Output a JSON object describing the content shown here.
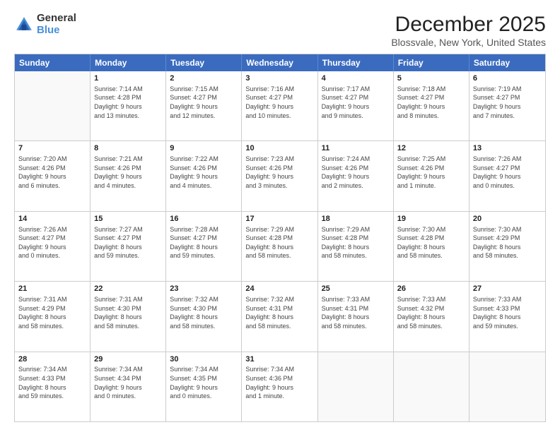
{
  "logo": {
    "general": "General",
    "blue": "Blue"
  },
  "title": "December 2025",
  "subtitle": "Blossvale, New York, United States",
  "calendar": {
    "headers": [
      "Sunday",
      "Monday",
      "Tuesday",
      "Wednesday",
      "Thursday",
      "Friday",
      "Saturday"
    ],
    "rows": [
      [
        {
          "day": "",
          "info": ""
        },
        {
          "day": "1",
          "info": "Sunrise: 7:14 AM\nSunset: 4:28 PM\nDaylight: 9 hours\nand 13 minutes."
        },
        {
          "day": "2",
          "info": "Sunrise: 7:15 AM\nSunset: 4:27 PM\nDaylight: 9 hours\nand 12 minutes."
        },
        {
          "day": "3",
          "info": "Sunrise: 7:16 AM\nSunset: 4:27 PM\nDaylight: 9 hours\nand 10 minutes."
        },
        {
          "day": "4",
          "info": "Sunrise: 7:17 AM\nSunset: 4:27 PM\nDaylight: 9 hours\nand 9 minutes."
        },
        {
          "day": "5",
          "info": "Sunrise: 7:18 AM\nSunset: 4:27 PM\nDaylight: 9 hours\nand 8 minutes."
        },
        {
          "day": "6",
          "info": "Sunrise: 7:19 AM\nSunset: 4:27 PM\nDaylight: 9 hours\nand 7 minutes."
        }
      ],
      [
        {
          "day": "7",
          "info": "Sunrise: 7:20 AM\nSunset: 4:26 PM\nDaylight: 9 hours\nand 6 minutes."
        },
        {
          "day": "8",
          "info": "Sunrise: 7:21 AM\nSunset: 4:26 PM\nDaylight: 9 hours\nand 4 minutes."
        },
        {
          "day": "9",
          "info": "Sunrise: 7:22 AM\nSunset: 4:26 PM\nDaylight: 9 hours\nand 4 minutes."
        },
        {
          "day": "10",
          "info": "Sunrise: 7:23 AM\nSunset: 4:26 PM\nDaylight: 9 hours\nand 3 minutes."
        },
        {
          "day": "11",
          "info": "Sunrise: 7:24 AM\nSunset: 4:26 PM\nDaylight: 9 hours\nand 2 minutes."
        },
        {
          "day": "12",
          "info": "Sunrise: 7:25 AM\nSunset: 4:26 PM\nDaylight: 9 hours\nand 1 minute."
        },
        {
          "day": "13",
          "info": "Sunrise: 7:26 AM\nSunset: 4:27 PM\nDaylight: 9 hours\nand 0 minutes."
        }
      ],
      [
        {
          "day": "14",
          "info": "Sunrise: 7:26 AM\nSunset: 4:27 PM\nDaylight: 9 hours\nand 0 minutes."
        },
        {
          "day": "15",
          "info": "Sunrise: 7:27 AM\nSunset: 4:27 PM\nDaylight: 8 hours\nand 59 minutes."
        },
        {
          "day": "16",
          "info": "Sunrise: 7:28 AM\nSunset: 4:27 PM\nDaylight: 8 hours\nand 59 minutes."
        },
        {
          "day": "17",
          "info": "Sunrise: 7:29 AM\nSunset: 4:28 PM\nDaylight: 8 hours\nand 58 minutes."
        },
        {
          "day": "18",
          "info": "Sunrise: 7:29 AM\nSunset: 4:28 PM\nDaylight: 8 hours\nand 58 minutes."
        },
        {
          "day": "19",
          "info": "Sunrise: 7:30 AM\nSunset: 4:28 PM\nDaylight: 8 hours\nand 58 minutes."
        },
        {
          "day": "20",
          "info": "Sunrise: 7:30 AM\nSunset: 4:29 PM\nDaylight: 8 hours\nand 58 minutes."
        }
      ],
      [
        {
          "day": "21",
          "info": "Sunrise: 7:31 AM\nSunset: 4:29 PM\nDaylight: 8 hours\nand 58 minutes."
        },
        {
          "day": "22",
          "info": "Sunrise: 7:31 AM\nSunset: 4:30 PM\nDaylight: 8 hours\nand 58 minutes."
        },
        {
          "day": "23",
          "info": "Sunrise: 7:32 AM\nSunset: 4:30 PM\nDaylight: 8 hours\nand 58 minutes."
        },
        {
          "day": "24",
          "info": "Sunrise: 7:32 AM\nSunset: 4:31 PM\nDaylight: 8 hours\nand 58 minutes."
        },
        {
          "day": "25",
          "info": "Sunrise: 7:33 AM\nSunset: 4:31 PM\nDaylight: 8 hours\nand 58 minutes."
        },
        {
          "day": "26",
          "info": "Sunrise: 7:33 AM\nSunset: 4:32 PM\nDaylight: 8 hours\nand 58 minutes."
        },
        {
          "day": "27",
          "info": "Sunrise: 7:33 AM\nSunset: 4:33 PM\nDaylight: 8 hours\nand 59 minutes."
        }
      ],
      [
        {
          "day": "28",
          "info": "Sunrise: 7:34 AM\nSunset: 4:33 PM\nDaylight: 8 hours\nand 59 minutes."
        },
        {
          "day": "29",
          "info": "Sunrise: 7:34 AM\nSunset: 4:34 PM\nDaylight: 9 hours\nand 0 minutes."
        },
        {
          "day": "30",
          "info": "Sunrise: 7:34 AM\nSunset: 4:35 PM\nDaylight: 9 hours\nand 0 minutes."
        },
        {
          "day": "31",
          "info": "Sunrise: 7:34 AM\nSunset: 4:36 PM\nDaylight: 9 hours\nand 1 minute."
        },
        {
          "day": "",
          "info": ""
        },
        {
          "day": "",
          "info": ""
        },
        {
          "day": "",
          "info": ""
        }
      ]
    ]
  }
}
